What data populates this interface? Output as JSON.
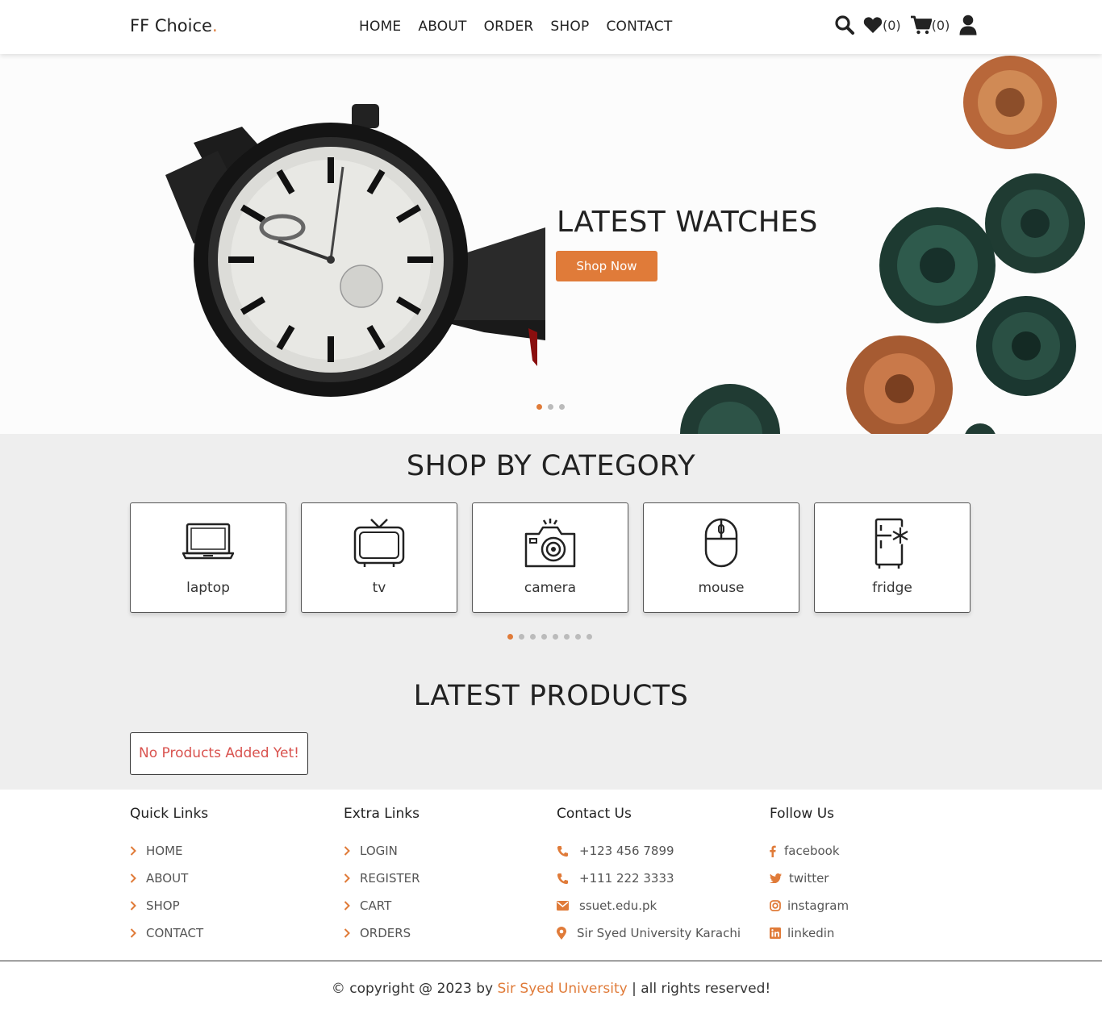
{
  "header": {
    "logo": "FF Choice",
    "logo_dot": ".",
    "nav": [
      "HOME",
      "ABOUT",
      "ORDER",
      "SHOP",
      "CONTACT"
    ],
    "wishlist_count": "(0)",
    "cart_count": "(0)",
    "icons": [
      "search-icon",
      "heart-icon",
      "cart-icon",
      "user-icon"
    ]
  },
  "hero": {
    "title": "LATEST WATCHES",
    "button": "Shop Now",
    "slides": 3,
    "active_slide": 1
  },
  "categories": {
    "title": "SHOP BY CATEGORY",
    "items": [
      {
        "label": "laptop",
        "icon": "laptop-icon"
      },
      {
        "label": "tv",
        "icon": "tv-icon"
      },
      {
        "label": "camera",
        "icon": "camera-icon"
      },
      {
        "label": "mouse",
        "icon": "mouse-icon"
      },
      {
        "label": "fridge",
        "icon": "fridge-icon"
      }
    ],
    "pages": 8,
    "active_page": 1
  },
  "latest": {
    "title": "LATEST PRODUCTS",
    "empty_message": "No Products Added Yet!"
  },
  "footer": {
    "quick_links": {
      "title": "Quick Links",
      "items": [
        "HOME",
        "ABOUT",
        "SHOP",
        "CONTACT"
      ]
    },
    "extra_links": {
      "title": "Extra Links",
      "items": [
        "LOGIN",
        "REGISTER",
        "CART",
        "ORDERS"
      ]
    },
    "contact": {
      "title": "Contact Us",
      "items": [
        {
          "text": "+123 456 7899",
          "icon": "phone-icon"
        },
        {
          "text": "+111 222 3333",
          "icon": "phone-icon"
        },
        {
          "text": "ssuet.edu.pk",
          "icon": "envelope-icon"
        },
        {
          "text": "Sir Syed University Karachi",
          "icon": "map-pin-icon"
        }
      ]
    },
    "follow": {
      "title": "Follow Us",
      "items": [
        {
          "text": "facebook",
          "icon": "facebook-icon"
        },
        {
          "text": "twitter",
          "icon": "twitter-icon"
        },
        {
          "text": "instagram",
          "icon": "instagram-icon"
        },
        {
          "text": "linkedin",
          "icon": "linkedin-icon"
        }
      ]
    },
    "copyright_prefix": "© copyright @ 2023 by ",
    "copyright_brand": "Sir Syed University",
    "copyright_suffix": " | all rights reserved!"
  },
  "colors": {
    "accent": "#e07b39",
    "section_bg": "#eeeeee",
    "error": "#d9534f"
  }
}
